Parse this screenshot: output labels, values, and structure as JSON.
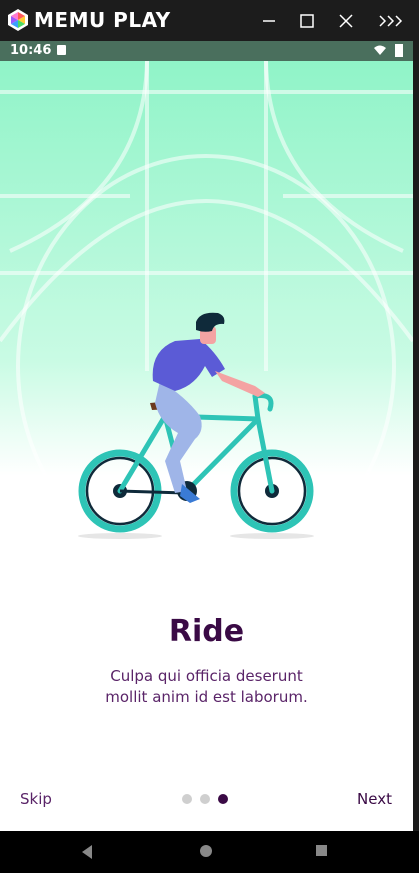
{
  "emulator": {
    "brand": "MEMU PLAY"
  },
  "statusbar": {
    "time": "10:46"
  },
  "onboarding": {
    "title": "Ride",
    "subtitle_line1": "Culpa qui officia deserunt",
    "subtitle_line2": "mollit anim id est laborum.",
    "skip_label": "Skip",
    "next_label": "Next",
    "page_indicator": {
      "total": 3,
      "current": 3
    }
  },
  "colors": {
    "accent": "#3a0a45",
    "hero_gradient_top": "#8cf3c6",
    "hero_gradient_bottom": "#ffffff",
    "shirt": "#5b5bd6",
    "bike": "#2ec4b6"
  },
  "icons": [
    "memu-logo-icon",
    "minimize-icon",
    "maximize-icon",
    "close-icon",
    "more-icon",
    "wifi-icon",
    "battery-icon",
    "back-icon",
    "home-icon",
    "recents-icon"
  ]
}
